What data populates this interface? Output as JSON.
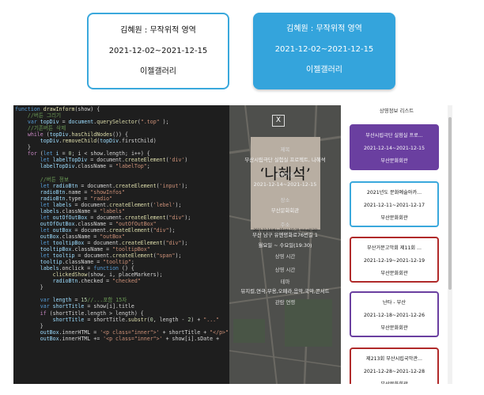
{
  "top_cards": [
    {
      "title": "김혜원 : 무작위적 영역",
      "dates": "2021-12-02~2021-12-15",
      "venue": "이젤갤러리"
    },
    {
      "title": "김혜원 : 무작위적 영역",
      "dates": "2021-12-02~2021-12-15",
      "venue": "이젤갤러리"
    }
  ],
  "code_lines": [
    [
      [
        "kw",
        "function "
      ],
      [
        "fn",
        "drawInform"
      ],
      [
        "",
        "(show) {"
      ]
    ],
    [
      [
        "cm",
        "    //버튼 그리기"
      ]
    ],
    [
      [
        "kw",
        "    var "
      ],
      [
        "var",
        "topDiv"
      ],
      [
        "",
        " = "
      ],
      [
        "var",
        "document"
      ],
      [
        "",
        "."
      ],
      [
        "fn",
        "querySelector"
      ],
      [
        "",
        "("
      ],
      [
        "str",
        "\".top\""
      ],
      [
        "",
        " );"
      ]
    ],
    [
      [
        "cm",
        "    //기존버튼 삭제"
      ]
    ],
    [
      [
        "kw2",
        "    while "
      ],
      [
        "",
        "("
      ],
      [
        "var",
        "topDiv"
      ],
      [
        "",
        "."
      ],
      [
        "fn",
        "hasChildNodes"
      ],
      [
        "",
        "()) {"
      ]
    ],
    [
      [
        "var",
        "        topDiv"
      ],
      [
        "",
        "."
      ],
      [
        "fn",
        "removeChild"
      ],
      [
        "",
        "("
      ],
      [
        "var",
        "topDiv"
      ],
      [
        "",
        ".firstChild)"
      ]
    ],
    [
      [
        "",
        "    }"
      ]
    ],
    [
      [
        "kw2",
        "    for "
      ],
      [
        "",
        "("
      ],
      [
        "kw",
        "let "
      ],
      [
        "var",
        "i"
      ],
      [
        "",
        " = "
      ],
      [
        "num",
        "0"
      ],
      [
        "",
        "; i < show.length; i++) {"
      ]
    ],
    [
      [
        "kw",
        "        let "
      ],
      [
        "var",
        "labelTopDiv"
      ],
      [
        "",
        " = document."
      ],
      [
        "fn",
        "createElement"
      ],
      [
        "",
        "("
      ],
      [
        "str",
        "'div'"
      ],
      [
        ")",
        ")"
      ]
    ],
    [
      [
        "var",
        "        labelTopDiv"
      ],
      [
        "",
        ".className = "
      ],
      [
        "str",
        "\"labelTop\""
      ],
      [
        "",
        ";"
      ]
    ],
    [
      [
        "",
        ""
      ]
    ],
    [
      [
        "cm",
        "        //버튼 정보"
      ]
    ],
    [
      [
        "kw",
        "        let "
      ],
      [
        "var",
        "radioBtn"
      ],
      [
        "",
        " = document."
      ],
      [
        "fn",
        "createElement"
      ],
      [
        "",
        "("
      ],
      [
        "str",
        "'input'"
      ],
      [
        "",
        ");"
      ]
    ],
    [
      [
        "var",
        "        radioBtn"
      ],
      [
        "",
        ".name = "
      ],
      [
        "str",
        "\"showInfos\""
      ]
    ],
    [
      [
        "var",
        "        radioBtn"
      ],
      [
        "",
        ".type = "
      ],
      [
        "str",
        "\"radio\""
      ]
    ],
    [
      [
        "kw",
        "        let "
      ],
      [
        "var",
        "labels"
      ],
      [
        "",
        " = document."
      ],
      [
        "fn",
        "createElement"
      ],
      [
        "",
        "("
      ],
      [
        "str",
        "'lebel'"
      ],
      [
        "",
        ");"
      ]
    ],
    [
      [
        "var",
        "        labels"
      ],
      [
        "",
        ".className = "
      ],
      [
        "str",
        "\"labels\""
      ]
    ],
    [
      [
        "kw",
        "        let "
      ],
      [
        "var",
        "outOfOutBox"
      ],
      [
        "",
        " = document."
      ],
      [
        "fn",
        "createElement"
      ],
      [
        "",
        "("
      ],
      [
        "str",
        "\"div\""
      ],
      [
        "",
        ");"
      ]
    ],
    [
      [
        "var",
        "        outOfOutBox"
      ],
      [
        "",
        ".className = "
      ],
      [
        "str",
        "\"outOfOutBox\""
      ]
    ],
    [
      [
        "kw",
        "        let "
      ],
      [
        "var",
        "outBox"
      ],
      [
        "",
        " = document."
      ],
      [
        "fn",
        "createElement"
      ],
      [
        "",
        "("
      ],
      [
        "str",
        "\"div\""
      ],
      [
        "",
        ");"
      ]
    ],
    [
      [
        "var",
        "        outBox"
      ],
      [
        "",
        ".className = "
      ],
      [
        "str",
        "\"outBox\""
      ]
    ],
    [
      [
        "kw",
        "        let "
      ],
      [
        "var",
        "tooltipBox"
      ],
      [
        "",
        " = document."
      ],
      [
        "fn",
        "createElement"
      ],
      [
        "",
        "("
      ],
      [
        "str",
        "\"div\""
      ],
      [
        "",
        ");"
      ]
    ],
    [
      [
        "var",
        "        tooltipBox"
      ],
      [
        "",
        ".className = "
      ],
      [
        "str",
        "\"tooltipBox\""
      ]
    ],
    [
      [
        "kw",
        "        let "
      ],
      [
        "var",
        "tooltip"
      ],
      [
        "",
        " = document."
      ],
      [
        "fn",
        "createElement"
      ],
      [
        "",
        "("
      ],
      [
        "str",
        "\"span\""
      ],
      [
        "",
        ");"
      ]
    ],
    [
      [
        "var",
        "        tooltip"
      ],
      [
        "",
        ".className = "
      ],
      [
        "str",
        "\"tooltip\""
      ],
      [
        "",
        ";"
      ]
    ],
    [
      [
        "var",
        "        labels"
      ],
      [
        "",
        ".onclick = "
      ],
      [
        "kw",
        "function "
      ],
      [
        "",
        "() {"
      ]
    ],
    [
      [
        "fn",
        "            clickedShow"
      ],
      [
        "",
        "(show, i, placeMarkers);"
      ]
    ],
    [
      [
        "var",
        "            radioBtn"
      ],
      [
        "",
        ".checked = "
      ],
      [
        "str",
        "\"checked\""
      ]
    ],
    [
      [
        "",
        "        }"
      ]
    ],
    [
      [
        "",
        ""
      ]
    ],
    [
      [
        "kw",
        "        var "
      ],
      [
        "var",
        "length"
      ],
      [
        "",
        " = "
      ],
      [
        "num",
        "15"
      ],
      [
        "cm",
        "//...포함 15자"
      ]
    ],
    [
      [
        "kw",
        "        var "
      ],
      [
        "var",
        "shortTitle"
      ],
      [
        "",
        " = show[i].title"
      ]
    ],
    [
      [
        "kw2",
        "        if "
      ],
      [
        "",
        "(shortTitle.length > length) {"
      ]
    ],
    [
      [
        "var",
        "            shortTitle"
      ],
      [
        "",
        " = shortTitle."
      ],
      [
        "fn",
        "substr"
      ],
      [
        "",
        "("
      ],
      [
        "num",
        "0"
      ],
      [
        "",
        ", length - "
      ],
      [
        "num",
        "2"
      ],
      [
        ") + ",
        ") + "
      ],
      [
        "str",
        "\"...\""
      ]
    ],
    [
      [
        "",
        "        }"
      ]
    ],
    [
      [
        "var",
        "        outBox"
      ],
      [
        "",
        ".innerHTML = "
      ],
      [
        "str",
        "'<p class=\"inner\">'"
      ],
      [
        "",
        " + shortTitle + "
      ],
      [
        "str",
        "\"</p>\""
      ]
    ],
    [
      [
        "var",
        "        outBox"
      ],
      [
        "",
        ".innerHTML += "
      ],
      [
        "str",
        "'<p class=\"inner\">'"
      ],
      [
        "",
        " + show[i].sDate +"
      ]
    ],
    [
      [
        "",
        ""
      ]
    ],
    [
      [
        "",
        ""
      ]
    ],
    [
      [
        "",
        ""
      ]
    ],
    [
      [
        "",
        ""
      ]
    ],
    [
      [
        "",
        ""
      ]
    ],
    [
      [
        "",
        ""
      ]
    ],
    [
      [
        "",
        ""
      ]
    ]
  ],
  "map_panel": {
    "close_label": "X",
    "poster_title": "‘나혜석’",
    "poster_small": "2021.12.14(화)~15(수) 15:30  부산시립극단 실험실",
    "info_lines": [
      {
        "text": "제목",
        "dim": true
      },
      {
        "text": "부산시립극단 실험실 프로젝트, 나혜석",
        "dim": false
      },
      {
        "text": "상영기간",
        "dim": true
      },
      {
        "text": "2021-12-14~2021-12-15",
        "dim": false
      },
      {
        "text": "장소",
        "dim": true
      },
      {
        "text": "부산문화회관",
        "dim": false
      },
      {
        "text": "주소",
        "dim": true
      },
      {
        "text": "부산 남구 유엔평화로76번길 1",
        "dim": false
      },
      {
        "text": "월요일 ~ 수요일(19:30)",
        "dim": false
      },
      {
        "text": "상영 시간",
        "dim": true
      },
      {
        "text": "상영 시간",
        "dim": true
      },
      {
        "text": "테마",
        "dim": true
      },
      {
        "text": "뮤지컬,연극,무용,오페라,음악,국악,콘서트",
        "dim": false
      },
      {
        "text": "관람 연령",
        "dim": true
      }
    ]
  },
  "list_panel": {
    "title": "상영정보 리스트",
    "items": [
      {
        "title": "부산시립극단 실험실 프로...",
        "dates": "2021-12-14~2021-12-15",
        "venue": "부산문화회관",
        "border": "#6a3fa0",
        "bg": "#6a3fa0",
        "fg": "#ffffff"
      },
      {
        "title": "2021년도 문화예술아카...",
        "dates": "2021-12-11~2021-12-17",
        "venue": "부산문화회관",
        "border": "#3aa8dc",
        "bg": "#ffffff",
        "fg": "#111111"
      },
      {
        "title": "부산거문고악회 제11회 ...",
        "dates": "2021-12-19~2021-12-19",
        "venue": "부산문화회관",
        "border": "#b02a2a",
        "bg": "#ffffff",
        "fg": "#111111"
      },
      {
        "title": "난타 - 부산",
        "dates": "2021-12-18~2021-12-26",
        "venue": "부산문화회관",
        "border": "#6a3fa0",
        "bg": "#ffffff",
        "fg": "#111111"
      },
      {
        "title": "제213회 부산시립국악관...",
        "dates": "2021-12-28~2021-12-28",
        "venue": "부산문화회관",
        "border": "#b02a2a",
        "bg": "#ffffff",
        "fg": "#111111"
      }
    ]
  }
}
